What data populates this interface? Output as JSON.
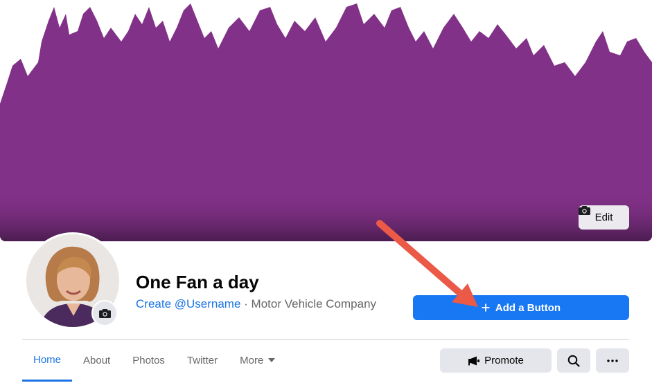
{
  "cover": {
    "edit_label": "Edit",
    "colors": {
      "purple": "#813187",
      "dark": "#4a1c4f"
    }
  },
  "profile": {
    "title": "One Fan a day",
    "username_link": "Create @Username",
    "separator": " · ",
    "category": "Motor Vehicle Company"
  },
  "actions": {
    "add_button_label": "Add a Button",
    "promote_label": "Promote"
  },
  "tabs": [
    {
      "label": "Home",
      "active": true
    },
    {
      "label": "About"
    },
    {
      "label": "Photos"
    },
    {
      "label": "Twitter"
    },
    {
      "label": "More"
    }
  ],
  "icons": {
    "camera": "camera-icon",
    "plus": "plus-icon",
    "megaphone": "megaphone-icon",
    "search": "search-icon",
    "ellipsis": "ellipsis-icon",
    "caret": "caret-down-icon"
  },
  "colors": {
    "accent": "#1877f2",
    "annotation_arrow": "#ea5a47"
  }
}
